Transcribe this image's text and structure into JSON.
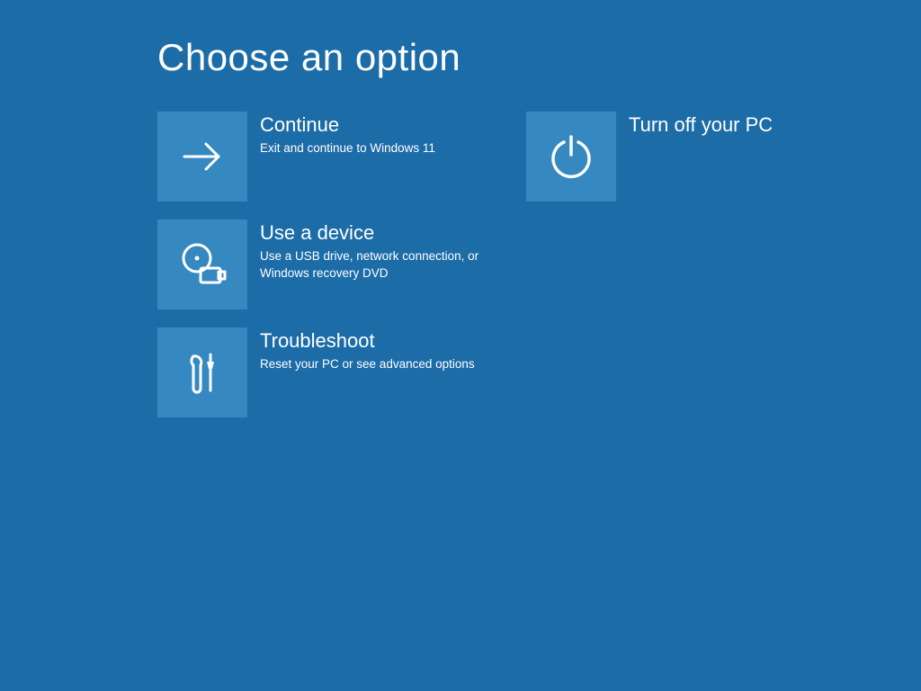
{
  "title": "Choose an option",
  "colors": {
    "background": "#1c6ca8",
    "tile": "#3688c0",
    "text": "#ffffff"
  },
  "options": [
    {
      "id": "continue",
      "title": "Continue",
      "desc": "Exit and continue to Windows 11",
      "icon": "arrow-right-icon"
    },
    {
      "id": "turnoff",
      "title": "Turn off your PC",
      "desc": "",
      "icon": "power-icon"
    },
    {
      "id": "usedevice",
      "title": "Use a device",
      "desc": "Use a USB drive, network connection, or Windows recovery DVD",
      "icon": "device-disc-icon"
    },
    {
      "id": "troubleshoot",
      "title": "Troubleshoot",
      "desc": "Reset your PC or see advanced options",
      "icon": "wrench-screwdriver-icon"
    }
  ]
}
